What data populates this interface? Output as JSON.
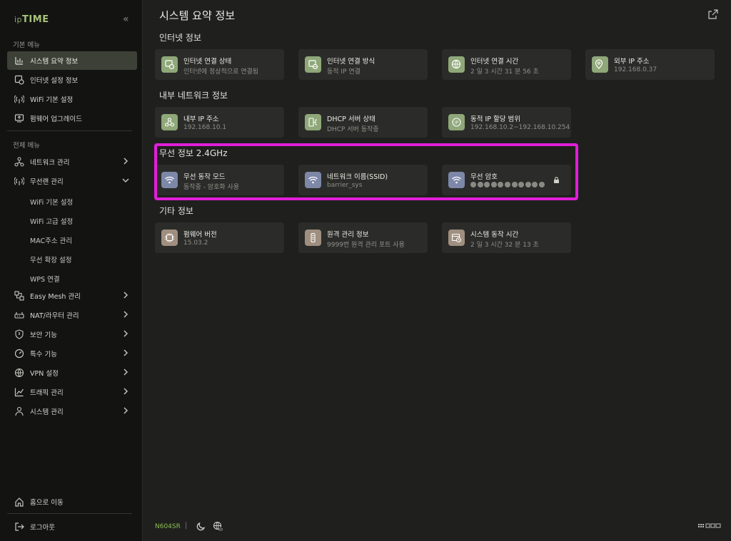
{
  "sidebar": {
    "logo_prefix": "ip",
    "logo_main": "TIME",
    "basic_menu_label": "기본 메뉴",
    "basic_items": [
      {
        "label": "시스템 요약 정보",
        "icon": "bar-chart-icon"
      },
      {
        "label": "인터넷 설정 정보",
        "icon": "internet-settings-icon"
      },
      {
        "label": "WiFi 기본 설정",
        "icon": "wifi-antenna-icon"
      },
      {
        "label": "펌웨어 업그레이드",
        "icon": "firmware-upgrade-icon"
      }
    ],
    "all_menu_label": "전체 메뉴",
    "all_items": [
      {
        "label": "네트워크 관리",
        "icon": "network-icon"
      },
      {
        "label": "무선랜 관리",
        "icon": "wireless-icon"
      },
      {
        "label": "Easy Mesh 관리",
        "icon": "mesh-icon"
      },
      {
        "label": "NAT/라우터 관리",
        "icon": "router-icon"
      },
      {
        "label": "보안 기능",
        "icon": "shield-icon"
      },
      {
        "label": "특수 기능",
        "icon": "gauge-icon"
      },
      {
        "label": "VPN 설정",
        "icon": "vpn-globe-icon"
      },
      {
        "label": "트래픽 관리",
        "icon": "traffic-chart-icon"
      },
      {
        "label": "시스템 관리",
        "icon": "system-user-icon"
      }
    ],
    "sub_items": [
      "WiFi 기본 설정",
      "WiFi 고급 설정",
      "MAC주소 관리",
      "무선 확장 설정",
      "WPS 연결"
    ],
    "home_label": "홈으로 이동",
    "logout_label": "로그아웃"
  },
  "main": {
    "page_title": "시스템 요약 정보",
    "sections": {
      "internet": {
        "title": "인터넷 정보",
        "cards": [
          {
            "title": "인터넷 연결 상태",
            "value": "인터넷에 정상적으로 연결됨"
          },
          {
            "title": "인터넷 연결 방식",
            "value": "동적 IP 연결"
          },
          {
            "title": "인터넷 연결 시간",
            "value": "2 일 3 시간 31 분 56 초"
          },
          {
            "title": "외부 IP 주소",
            "value": "192.168.0.37"
          }
        ]
      },
      "lan": {
        "title": "내부 네트워크 정보",
        "cards": [
          {
            "title": "내부 IP 주소",
            "value": "192.168.10.1"
          },
          {
            "title": "DHCP 서버 상태",
            "value": "DHCP 서버 동작중"
          },
          {
            "title": "동적 IP 할당 범위",
            "value": "192.168.10.2~192.168.10.254"
          }
        ]
      },
      "wireless": {
        "title": "무선 정보 2.4GHz",
        "cards": [
          {
            "title": "무선 동작 모드",
            "value": "동작중 - 암호화 사용"
          },
          {
            "title": "네트워크 이름(SSID)",
            "value": "barrier_sys"
          },
          {
            "title": "무선 암호",
            "masked_dots": 11
          }
        ]
      },
      "other": {
        "title": "기타 정보",
        "cards": [
          {
            "title": "펌웨어 버전",
            "value": "15.03.2"
          },
          {
            "title": "원격 관리 정보",
            "value": "9999번 원격 관리 포트 사용"
          },
          {
            "title": "시스템 동작 시간",
            "value": "2 일 3 시간 32 분 13 초"
          }
        ]
      }
    }
  },
  "footer": {
    "model": "N604SR",
    "separator": "|"
  },
  "colors": {
    "accent_green": "#8dbf55",
    "highlight_magenta": "#e11ed8",
    "icon_green": "#8fa779",
    "icon_blue": "#7d87a8",
    "icon_tan": "#a08f80"
  }
}
